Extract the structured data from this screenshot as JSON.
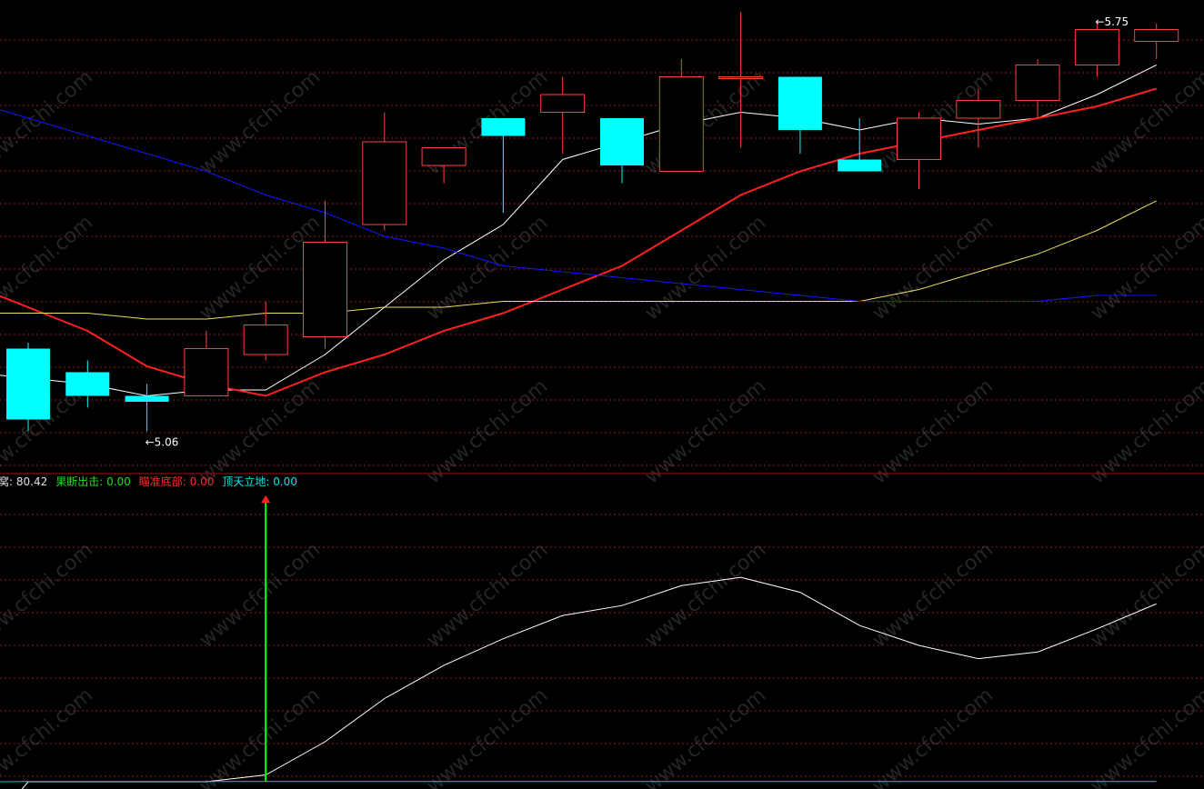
{
  "chart_data": [
    {
      "type": "candlestick",
      "x": [
        1,
        2,
        3,
        4,
        5,
        6,
        7,
        8,
        9,
        10,
        11,
        12,
        13,
        14,
        15,
        16,
        17,
        18,
        19,
        20
      ],
      "candles": [
        {
          "open": 5.2,
          "high": 5.21,
          "low": 5.06,
          "close": 5.08
        },
        {
          "open": 5.16,
          "high": 5.18,
          "low": 5.1,
          "close": 5.12
        },
        {
          "open": 5.12,
          "high": 5.14,
          "low": 5.06,
          "close": 5.11
        },
        {
          "open": 5.12,
          "high": 5.23,
          "low": 5.12,
          "close": 5.2
        },
        {
          "open": 5.19,
          "high": 5.28,
          "low": 5.18,
          "close": 5.24
        },
        {
          "open": 5.22,
          "high": 5.45,
          "low": 5.2,
          "close": 5.38
        },
        {
          "open": 5.41,
          "high": 5.6,
          "low": 5.4,
          "close": 5.55
        },
        {
          "open": 5.51,
          "high": 5.54,
          "low": 5.48,
          "close": 5.54
        },
        {
          "open": 5.59,
          "high": 5.59,
          "low": 5.43,
          "close": 5.56
        },
        {
          "open": 5.6,
          "high": 5.66,
          "low": 5.53,
          "close": 5.63
        },
        {
          "open": 5.59,
          "high": 5.59,
          "low": 5.48,
          "close": 5.51
        },
        {
          "open": 5.5,
          "high": 5.69,
          "low": 5.5,
          "close": 5.66
        },
        {
          "open": 5.66,
          "high": 5.77,
          "low": 5.54,
          "close": 5.66
        },
        {
          "open": 5.66,
          "high": 5.66,
          "low": 5.53,
          "close": 5.57
        },
        {
          "open": 5.52,
          "high": 5.59,
          "low": 5.5,
          "close": 5.5
        },
        {
          "open": 5.52,
          "high": 5.6,
          "low": 5.47,
          "close": 5.59
        },
        {
          "open": 5.59,
          "high": 5.64,
          "low": 5.54,
          "close": 5.62
        },
        {
          "open": 5.62,
          "high": 5.69,
          "low": 5.59,
          "close": 5.68
        },
        {
          "open": 5.68,
          "high": 5.75,
          "low": 5.66,
          "close": 5.74
        },
        {
          "open": 5.72,
          "high": 5.75,
          "low": 5.69,
          "close": 5.74
        }
      ],
      "moving_averages": [
        {
          "color": "#ffffff",
          "values": [
            5.15,
            5.14,
            5.12,
            5.13,
            5.13,
            5.19,
            5.27,
            5.35,
            5.41,
            5.52,
            5.55,
            5.58,
            5.6,
            5.59,
            5.57,
            5.59,
            5.58,
            5.59,
            5.63,
            5.68
          ]
        },
        {
          "color": "#ff2020",
          "values": [
            5.27,
            5.23,
            5.17,
            5.14,
            5.12,
            5.16,
            5.19,
            5.23,
            5.26,
            5.3,
            5.34,
            5.4,
            5.46,
            5.5,
            5.53,
            5.55,
            5.57,
            5.59,
            5.61,
            5.64
          ]
        },
        {
          "color": "#e8e060",
          "values": [
            5.26,
            5.26,
            5.25,
            5.25,
            5.26,
            5.26,
            5.27,
            5.27,
            5.28,
            5.28,
            5.28,
            5.28,
            5.28,
            5.28,
            5.28,
            5.3,
            5.33,
            5.36,
            5.4,
            5.45
          ]
        },
        {
          "color": "#1515ff",
          "values": [
            5.59,
            5.56,
            5.53,
            5.5,
            5.46,
            5.43,
            5.39,
            5.37,
            5.34,
            5.33,
            5.32,
            5.31,
            5.3,
            5.29,
            5.28,
            5.28,
            5.28,
            5.28,
            5.29,
            5.29
          ]
        }
      ],
      "annotations": [
        {
          "text": "5.06",
          "x": 3,
          "y": 5.06
        },
        {
          "text": "5.75",
          "x": 19,
          "y": 5.75
        }
      ],
      "ylim": [
        4.99,
        5.79
      ],
      "grid": true
    },
    {
      "type": "line",
      "x": [
        1,
        2,
        3,
        4,
        5,
        6,
        7,
        8,
        9,
        10,
        11,
        12,
        13,
        14,
        15,
        16,
        17,
        18,
        19,
        20
      ],
      "series": [
        {
          "color": "#ffffff",
          "values": [
            -12.0,
            -16.0,
            -17.0,
            -16.0,
            2.0,
            12.0,
            25.0,
            35.0,
            43.0,
            50.0,
            53.0,
            59.0,
            61.5,
            57.0,
            47.0,
            41.0,
            37.0,
            39.0,
            46.0,
            53.5
          ]
        },
        {
          "color": "#00c8c8",
          "values": [
            0,
            0,
            0,
            0,
            0,
            0,
            0,
            0,
            0,
            0,
            0,
            0,
            0,
            0,
            0,
            0,
            0,
            0,
            0,
            0
          ]
        }
      ],
      "signals": [
        {
          "x": 5,
          "label": "up-arrow",
          "color": "#00ff00"
        }
      ],
      "ylim": [
        -0.6,
        90
      ],
      "grid": true,
      "legend_position": "top-left",
      "legend": [
        {
          "name": "主窝",
          "value": "80.42",
          "color": "#e0e0e0"
        },
        {
          "name": "果断出击",
          "value": "0.00",
          "color": "#19e119"
        },
        {
          "name": "瞄准底部",
          "value": "0.00",
          "color": "#ff2a2a"
        },
        {
          "name": "顶天立地",
          "value": "0.00",
          "color": "#00e5e5"
        }
      ]
    }
  ],
  "watermark": "www.cfchi.com",
  "colors": {
    "background": "#000000",
    "grid": "#8b1a1a",
    "separator": "#a01010",
    "up": "#ff4040",
    "down": "#00ffff",
    "label": "#ffffff"
  }
}
